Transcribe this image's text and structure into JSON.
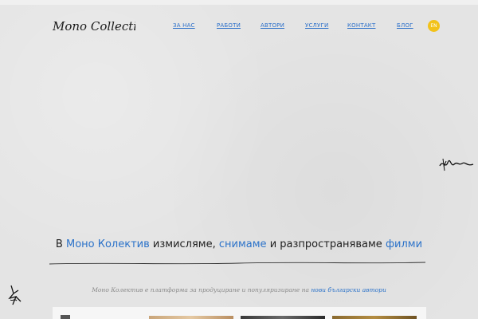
{
  "brand": {
    "logo_text": "Mono Collective"
  },
  "nav": {
    "items": [
      {
        "label": "ЗА НАС"
      },
      {
        "label": "РАБОТИ"
      },
      {
        "label": "АВТОРИ"
      },
      {
        "label": "УСЛУГИ"
      },
      {
        "label": "КОНТАКТ"
      },
      {
        "label": "БЛОГ"
      }
    ],
    "lang": "EN"
  },
  "hero": {
    "part1": "В ",
    "link1": "Моно Колектив",
    "part2": " измисляме, ",
    "link2": "снимаме",
    "part3": " и разпространяваме ",
    "link3": "филми"
  },
  "intro": {
    "text": "Моно Колектив е платформа за продуциране и популяризиране на ",
    "link": "нови български автори"
  },
  "colors": {
    "link": "#2b72c9",
    "lang_badge": "#f2c21a"
  }
}
